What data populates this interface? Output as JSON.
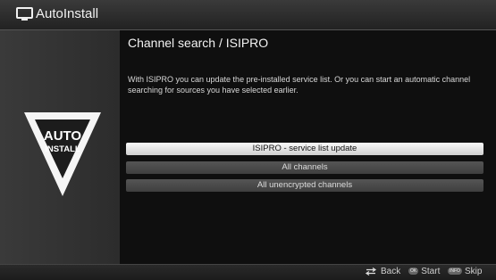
{
  "header": {
    "title": "AutoInstall",
    "icon": "tv-icon"
  },
  "logo": {
    "line1": "AUTO",
    "line2": "INSTALL"
  },
  "content": {
    "heading": "Channel search / ISIPRO",
    "description": "With ISIPRO you can update the pre-installed service list. Or you can start an automatic channel searching for sources you have selected earlier."
  },
  "menu": {
    "items": [
      {
        "label": "ISIPRO - service list update",
        "selected": true
      },
      {
        "label": "All channels",
        "selected": false
      },
      {
        "label": "All unencrypted channels",
        "selected": false
      }
    ]
  },
  "footer": {
    "back_label": "Back",
    "ok_key": "OK",
    "start_label": "Start",
    "info_key": "INFO",
    "skip_label": "Skip"
  },
  "colors": {
    "selected_bg": "#f0f0f0",
    "item_bg": "#4a4a4a",
    "panel_bg": "#0f0f0f"
  }
}
